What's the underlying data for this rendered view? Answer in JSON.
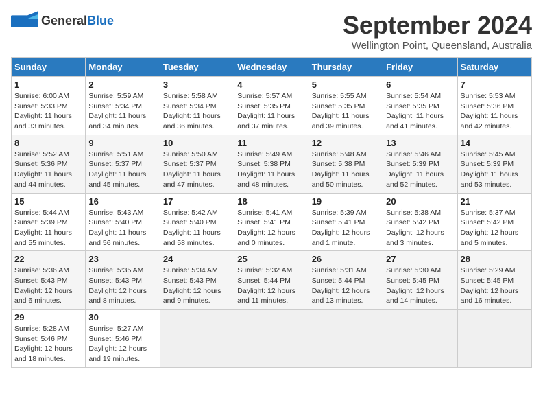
{
  "header": {
    "logo_general": "General",
    "logo_blue": "Blue",
    "month": "September 2024",
    "location": "Wellington Point, Queensland, Australia"
  },
  "days_of_week": [
    "Sunday",
    "Monday",
    "Tuesday",
    "Wednesday",
    "Thursday",
    "Friday",
    "Saturday"
  ],
  "weeks": [
    [
      {
        "day": 1,
        "sunrise": "6:00 AM",
        "sunset": "5:33 PM",
        "daylight": "11 hours and 33 minutes."
      },
      {
        "day": 2,
        "sunrise": "5:59 AM",
        "sunset": "5:34 PM",
        "daylight": "11 hours and 34 minutes."
      },
      {
        "day": 3,
        "sunrise": "5:58 AM",
        "sunset": "5:34 PM",
        "daylight": "11 hours and 36 minutes."
      },
      {
        "day": 4,
        "sunrise": "5:57 AM",
        "sunset": "5:35 PM",
        "daylight": "11 hours and 37 minutes."
      },
      {
        "day": 5,
        "sunrise": "5:55 AM",
        "sunset": "5:35 PM",
        "daylight": "11 hours and 39 minutes."
      },
      {
        "day": 6,
        "sunrise": "5:54 AM",
        "sunset": "5:35 PM",
        "daylight": "11 hours and 41 minutes."
      },
      {
        "day": 7,
        "sunrise": "5:53 AM",
        "sunset": "5:36 PM",
        "daylight": "11 hours and 42 minutes."
      }
    ],
    [
      {
        "day": 8,
        "sunrise": "5:52 AM",
        "sunset": "5:36 PM",
        "daylight": "11 hours and 44 minutes."
      },
      {
        "day": 9,
        "sunrise": "5:51 AM",
        "sunset": "5:37 PM",
        "daylight": "11 hours and 45 minutes."
      },
      {
        "day": 10,
        "sunrise": "5:50 AM",
        "sunset": "5:37 PM",
        "daylight": "11 hours and 47 minutes."
      },
      {
        "day": 11,
        "sunrise": "5:49 AM",
        "sunset": "5:38 PM",
        "daylight": "11 hours and 48 minutes."
      },
      {
        "day": 12,
        "sunrise": "5:48 AM",
        "sunset": "5:38 PM",
        "daylight": "11 hours and 50 minutes."
      },
      {
        "day": 13,
        "sunrise": "5:46 AM",
        "sunset": "5:39 PM",
        "daylight": "11 hours and 52 minutes."
      },
      {
        "day": 14,
        "sunrise": "5:45 AM",
        "sunset": "5:39 PM",
        "daylight": "11 hours and 53 minutes."
      }
    ],
    [
      {
        "day": 15,
        "sunrise": "5:44 AM",
        "sunset": "5:39 PM",
        "daylight": "11 hours and 55 minutes."
      },
      {
        "day": 16,
        "sunrise": "5:43 AM",
        "sunset": "5:40 PM",
        "daylight": "11 hours and 56 minutes."
      },
      {
        "day": 17,
        "sunrise": "5:42 AM",
        "sunset": "5:40 PM",
        "daylight": "11 hours and 58 minutes."
      },
      {
        "day": 18,
        "sunrise": "5:41 AM",
        "sunset": "5:41 PM",
        "daylight": "12 hours and 0 minutes."
      },
      {
        "day": 19,
        "sunrise": "5:39 AM",
        "sunset": "5:41 PM",
        "daylight": "12 hours and 1 minute."
      },
      {
        "day": 20,
        "sunrise": "5:38 AM",
        "sunset": "5:42 PM",
        "daylight": "12 hours and 3 minutes."
      },
      {
        "day": 21,
        "sunrise": "5:37 AM",
        "sunset": "5:42 PM",
        "daylight": "12 hours and 5 minutes."
      }
    ],
    [
      {
        "day": 22,
        "sunrise": "5:36 AM",
        "sunset": "5:43 PM",
        "daylight": "12 hours and 6 minutes."
      },
      {
        "day": 23,
        "sunrise": "5:35 AM",
        "sunset": "5:43 PM",
        "daylight": "12 hours and 8 minutes."
      },
      {
        "day": 24,
        "sunrise": "5:34 AM",
        "sunset": "5:43 PM",
        "daylight": "12 hours and 9 minutes."
      },
      {
        "day": 25,
        "sunrise": "5:32 AM",
        "sunset": "5:44 PM",
        "daylight": "12 hours and 11 minutes."
      },
      {
        "day": 26,
        "sunrise": "5:31 AM",
        "sunset": "5:44 PM",
        "daylight": "12 hours and 13 minutes."
      },
      {
        "day": 27,
        "sunrise": "5:30 AM",
        "sunset": "5:45 PM",
        "daylight": "12 hours and 14 minutes."
      },
      {
        "day": 28,
        "sunrise": "5:29 AM",
        "sunset": "5:45 PM",
        "daylight": "12 hours and 16 minutes."
      }
    ],
    [
      {
        "day": 29,
        "sunrise": "5:28 AM",
        "sunset": "5:46 PM",
        "daylight": "12 hours and 18 minutes."
      },
      {
        "day": 30,
        "sunrise": "5:27 AM",
        "sunset": "5:46 PM",
        "daylight": "12 hours and 19 minutes."
      },
      null,
      null,
      null,
      null,
      null
    ]
  ]
}
